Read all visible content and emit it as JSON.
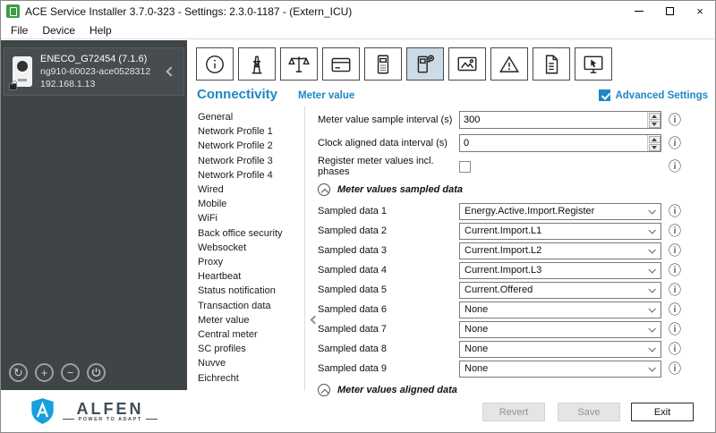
{
  "window": {
    "title": "ACE Service Installer 3.7.0-323 - Settings: 2.3.0-1187 - (Extern_ICU)"
  },
  "menu": {
    "items": [
      "File",
      "Device",
      "Help"
    ]
  },
  "sidebar": {
    "device": {
      "name": "ENECO_G72454 (7.1.6)",
      "code": "ng910-60023-ace0528312",
      "ip": "192.168.1.13"
    },
    "logo": {
      "brand": "ALFEN",
      "tagline": "POWER TO ADAPT"
    }
  },
  "toolbar": {
    "buttons": [
      {
        "name": "info",
        "selected": false
      },
      {
        "name": "grid-power",
        "selected": false
      },
      {
        "name": "load-balancing",
        "selected": false
      },
      {
        "name": "rfid-card",
        "selected": false
      },
      {
        "name": "payment-terminal",
        "selected": false
      },
      {
        "name": "charge-point-connectivity",
        "selected": true
      },
      {
        "name": "display",
        "selected": false
      },
      {
        "name": "warnings",
        "selected": false
      },
      {
        "name": "logging",
        "selected": false
      },
      {
        "name": "remote-session",
        "selected": false
      }
    ]
  },
  "content": {
    "section_title": "Connectivity",
    "page_title": "Meter value",
    "advanced_settings": {
      "label": "Advanced Settings",
      "checked": true
    },
    "nav": [
      "General",
      "Network Profile 1",
      "Network Profile 2",
      "Network Profile 3",
      "Network Profile 4",
      "Wired",
      "Mobile",
      "WiFi",
      "Back office security",
      "Websocket",
      "Proxy",
      "Heartbeat",
      "Status notification",
      "Transaction data",
      "Meter value",
      "Central meter",
      "SC profiles",
      "Nuvve",
      "Eichrecht"
    ],
    "selected_nav": "Meter value",
    "fields": {
      "sample_interval": {
        "label": "Meter value sample interval (s)",
        "value": "300"
      },
      "clock_aligned": {
        "label": "Clock aligned data interval (s)",
        "value": "0"
      },
      "register_phases": {
        "label": "Register meter values incl. phases",
        "checked": false
      }
    },
    "sampled_section": {
      "title": "Meter values sampled data"
    },
    "sampled_rows": [
      {
        "label": "Sampled data 1",
        "value": "Energy.Active.Import.Register"
      },
      {
        "label": "Sampled data 2",
        "value": "Current.Import.L1"
      },
      {
        "label": "Sampled data 3",
        "value": "Current.Import.L2"
      },
      {
        "label": "Sampled data 4",
        "value": "Current.Import.L3"
      },
      {
        "label": "Sampled data 5",
        "value": "Current.Offered"
      },
      {
        "label": "Sampled data 6",
        "value": "None"
      },
      {
        "label": "Sampled data 7",
        "value": "None"
      },
      {
        "label": "Sampled data 8",
        "value": "None"
      },
      {
        "label": "Sampled data 9",
        "value": "None"
      }
    ],
    "aligned_section": {
      "title": "Meter values aligned data"
    }
  },
  "footer": {
    "revert": "Revert",
    "save": "Save",
    "exit": "Exit"
  },
  "icons": {
    "info": "ⓘ",
    "refresh": "↻",
    "add": "+",
    "remove": "−",
    "close": "×"
  }
}
